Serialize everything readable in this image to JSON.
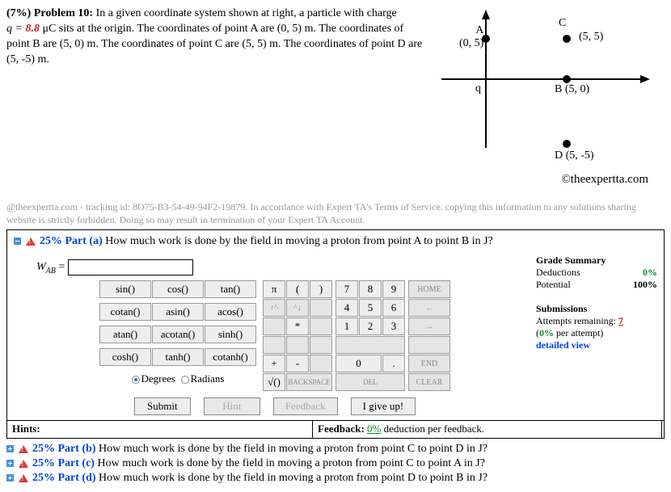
{
  "problem": {
    "header_prefix": "(7%)  Problem 10: ",
    "text_before_q": "  In a given coordinate system shown at right, a particle with charge",
    "q_label": "q = ",
    "q_value": "8.8",
    "q_unit": " μC sits at the origin. The coordinates of point A are (0, 5) m. The coordinates of point B are (5, 0) m. The coordinates of point C are (5, 5) m. The coordinates of point D are (5, -5) m."
  },
  "diagram": {
    "A": {
      "label": "A",
      "coord": "(0, 5)"
    },
    "B": {
      "label": "B (5, 0)",
      "coord": ""
    },
    "C": {
      "label": "C",
      "coord": "(5, 5)"
    },
    "D": {
      "label": "D  (5, -5)",
      "coord": ""
    },
    "q": "q"
  },
  "copyright": "©theexpertta.com",
  "tracking": "@theexpertta.com - tracking id: 8O75-B3-54-49-94F2-19879. In accordance with Expert TA's Terms of Service. copying this information to any solutions sharing website is strictly forbidden. Doing so may result in termination of your Expert TA Account.",
  "part_a": {
    "percent": "25% Part (a)",
    "question": "  How much work is done by the field in moving a proton from point A to point B in J?",
    "var_main": "W",
    "var_sub": "AB",
    "equals": " = "
  },
  "grade": {
    "header": "Grade Summary",
    "ded_label": "Deductions",
    "ded_val": "0%",
    "pot_label": "Potential",
    "pot_val": "100%",
    "sub_header": "Submissions",
    "attempts_label": "Attempts remaining:",
    "attempts_val": "7",
    "perattempt_pre": "(",
    "perattempt_val": "0%",
    "perattempt_post": " per attempt)",
    "detailed": "detailed view"
  },
  "calc": {
    "funcs": [
      "sin()",
      "cos()",
      "tan()",
      "cotan()",
      "asin()",
      "acos()",
      "atan()",
      "acotan()",
      "sinh()",
      "cosh()",
      "tanh()",
      "cotanh()"
    ],
    "mode_deg": "Degrees",
    "mode_rad": "Radians",
    "syms_r1": [
      "π",
      "(",
      ")"
    ],
    "syms_r2": [
      "↑^",
      "^↓",
      ""
    ],
    "syms_r3": [
      "",
      "*",
      ""
    ],
    "syms_r4": [
      "",
      "",
      ""
    ],
    "syms_r5": [
      "+",
      "-",
      ""
    ],
    "syms_r6": "√()",
    "nums": [
      "7",
      "8",
      "9",
      "4",
      "5",
      "6",
      "1",
      "2",
      "3"
    ],
    "zero": "0",
    "dot": ".",
    "backspace": "BACKSPACE",
    "del": "DEL",
    "side": [
      "HOME",
      "←",
      "→",
      "",
      "END",
      "CLEAR"
    ]
  },
  "actions": {
    "submit": "Submit",
    "hint": "Hint",
    "feedback": "Feedback",
    "giveup": "I give up!"
  },
  "hints": {
    "label": "Hints:",
    "feedback_label": "Feedback: ",
    "feedback_val": "0%",
    "feedback_post": "  deduction per feedback."
  },
  "other_parts": {
    "b": {
      "pct": "25% Part (b)",
      "q": "  How much work is done by the field in moving a proton from point C to point D in J?"
    },
    "c": {
      "pct": "25% Part (c)",
      "q": "  How much work is done by the field in moving a proton from point C to point A in J?"
    },
    "d": {
      "pct": "25% Part (d)",
      "q": "  How much work is done by the field in moving a proton from point D to point B in J?"
    }
  }
}
